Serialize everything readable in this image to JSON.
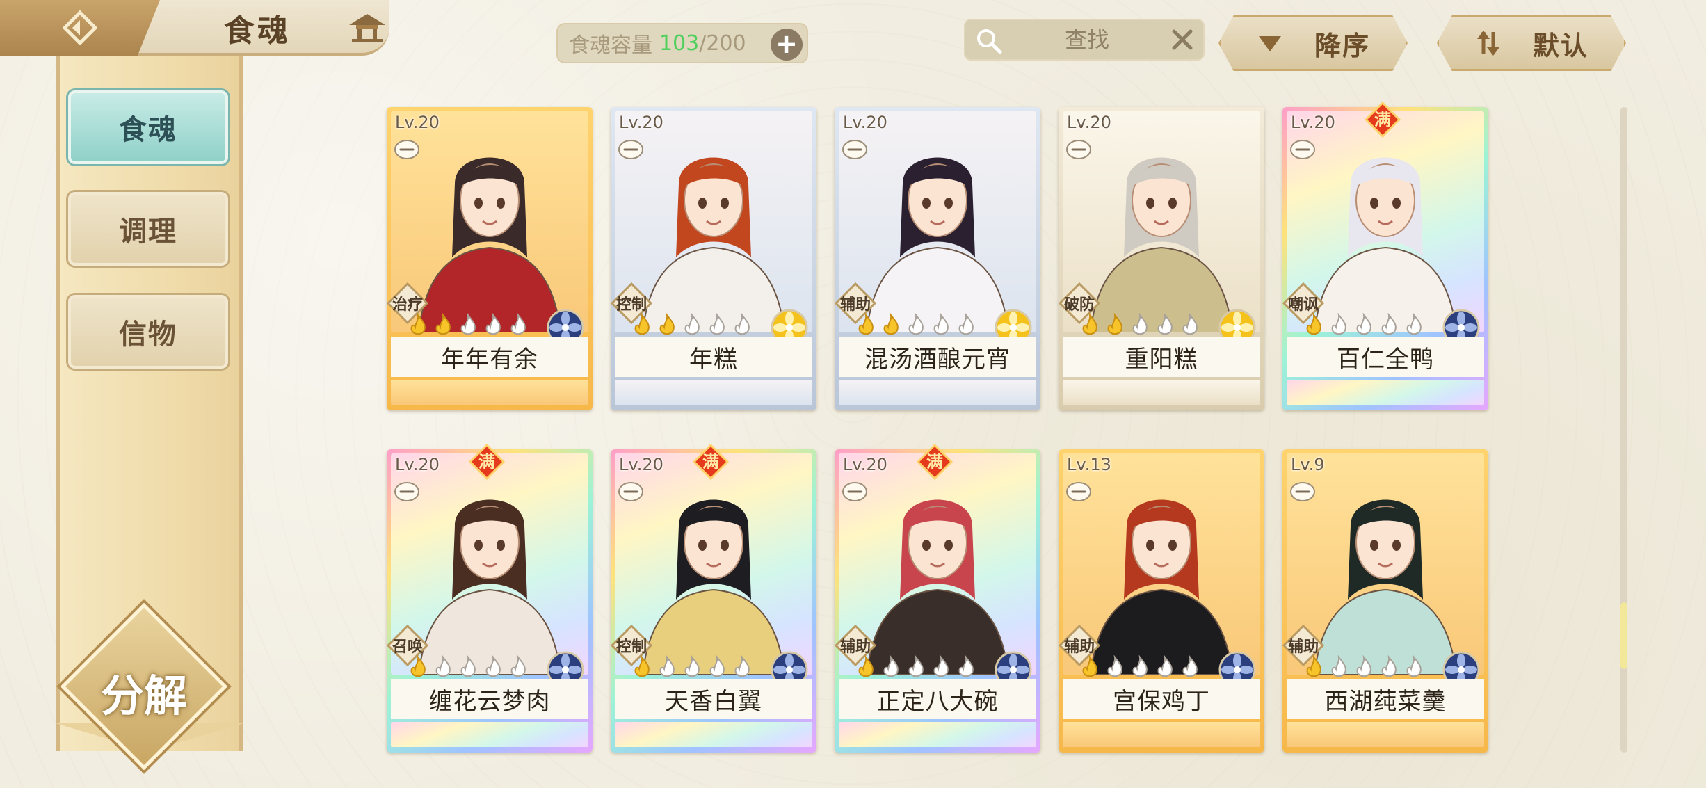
{
  "header": {
    "title": "食魂",
    "capacity_label": "食魂容量",
    "capacity_current": "103",
    "capacity_max": "/200",
    "search_placeholder": "查找",
    "sort_order_label": "降序",
    "sort_mode_label": "默认"
  },
  "sidebar": {
    "tabs": [
      {
        "label": "食魂",
        "active": true
      },
      {
        "label": "调理",
        "active": false
      },
      {
        "label": "信物",
        "active": false
      }
    ],
    "decompose_label": "分解"
  },
  "cards": [
    {
      "level": "Lv.20",
      "name": "年年有余",
      "role": "治疗",
      "stars": 2,
      "full": false,
      "frame": "gold",
      "element": "blue"
    },
    {
      "level": "Lv.20",
      "name": "年糕",
      "role": "控制",
      "stars": 2,
      "full": false,
      "frame": "silver",
      "element": "gold"
    },
    {
      "level": "Lv.20",
      "name": "混汤酒酿元宵",
      "role": "辅助",
      "stars": 2,
      "full": false,
      "frame": "silver",
      "element": "gold"
    },
    {
      "level": "Lv.20",
      "name": "重阳糕",
      "role": "破防",
      "stars": 2,
      "full": false,
      "frame": "tan",
      "element": "gold"
    },
    {
      "level": "Lv.20",
      "name": "百仁全鸭",
      "role": "嘲讽",
      "stars": 1,
      "full": true,
      "full_label": "满",
      "frame": "rainbow",
      "element": "blue"
    },
    {
      "level": "Lv.20",
      "name": "缠花云梦肉",
      "role": "召唤",
      "stars": 1,
      "full": true,
      "full_label": "满",
      "frame": "rainbow",
      "element": "blue"
    },
    {
      "level": "Lv.20",
      "name": "天香白翼",
      "role": "控制",
      "stars": 1,
      "full": true,
      "full_label": "满",
      "frame": "rainbow",
      "element": "blue"
    },
    {
      "level": "Lv.20",
      "name": "正定八大碗",
      "role": "辅助",
      "stars": 1,
      "full": true,
      "full_label": "满",
      "frame": "rainbow",
      "element": "blue"
    },
    {
      "level": "Lv.13",
      "name": "宫保鸡丁",
      "role": "辅助",
      "stars": 1,
      "full": false,
      "frame": "gold",
      "element": "blue"
    },
    {
      "level": "Lv.9",
      "name": "西湖莼菜羹",
      "role": "辅助",
      "stars": 1,
      "full": false,
      "frame": "gold",
      "element": "blue"
    }
  ],
  "colors": {
    "accent_teal": "#8fd1c8",
    "gold_frame": "#f7b84a",
    "capacity_green": "#4fcf5c",
    "element_blue": "#2b3f7e",
    "element_gold": "#f5c21b"
  },
  "icons": {
    "back": "back-arrow-icon",
    "hall": "pavilion-icon",
    "search": "magnifier-icon",
    "clear": "close-icon",
    "sort_desc": "triangle-down-icon",
    "sort_mode": "swap-arrows-icon"
  }
}
